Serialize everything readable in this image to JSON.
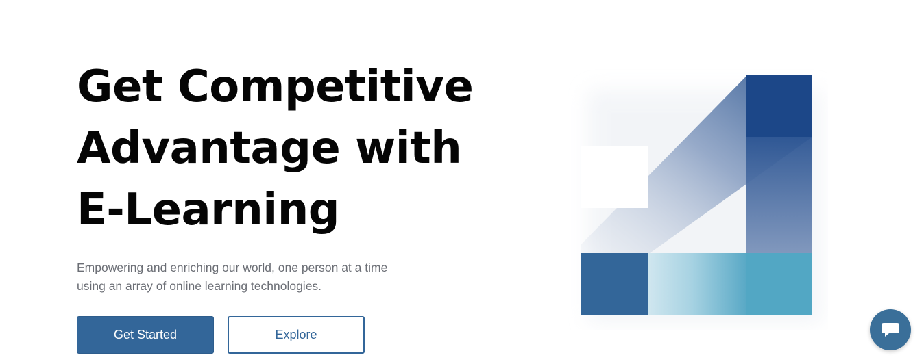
{
  "hero": {
    "title_lines": [
      "Get Competitive",
      "Advantage with",
      "E-Learning"
    ],
    "subtitle_lines": [
      "Empowering and enriching our world, one person at a time",
      "using an array of online learning technologies."
    ],
    "primary_button": "Get Started",
    "secondary_button": "Explore"
  },
  "graphic": {
    "icon": "brand-4-logo-graphic"
  },
  "chat": {
    "icon": "chat-bubble-icon"
  },
  "colors": {
    "primary": "#336699",
    "dark_blue": "#1c4788",
    "teal": "#52a7c4",
    "text_dark": "#050505",
    "text_muted": "#6b6e75"
  }
}
